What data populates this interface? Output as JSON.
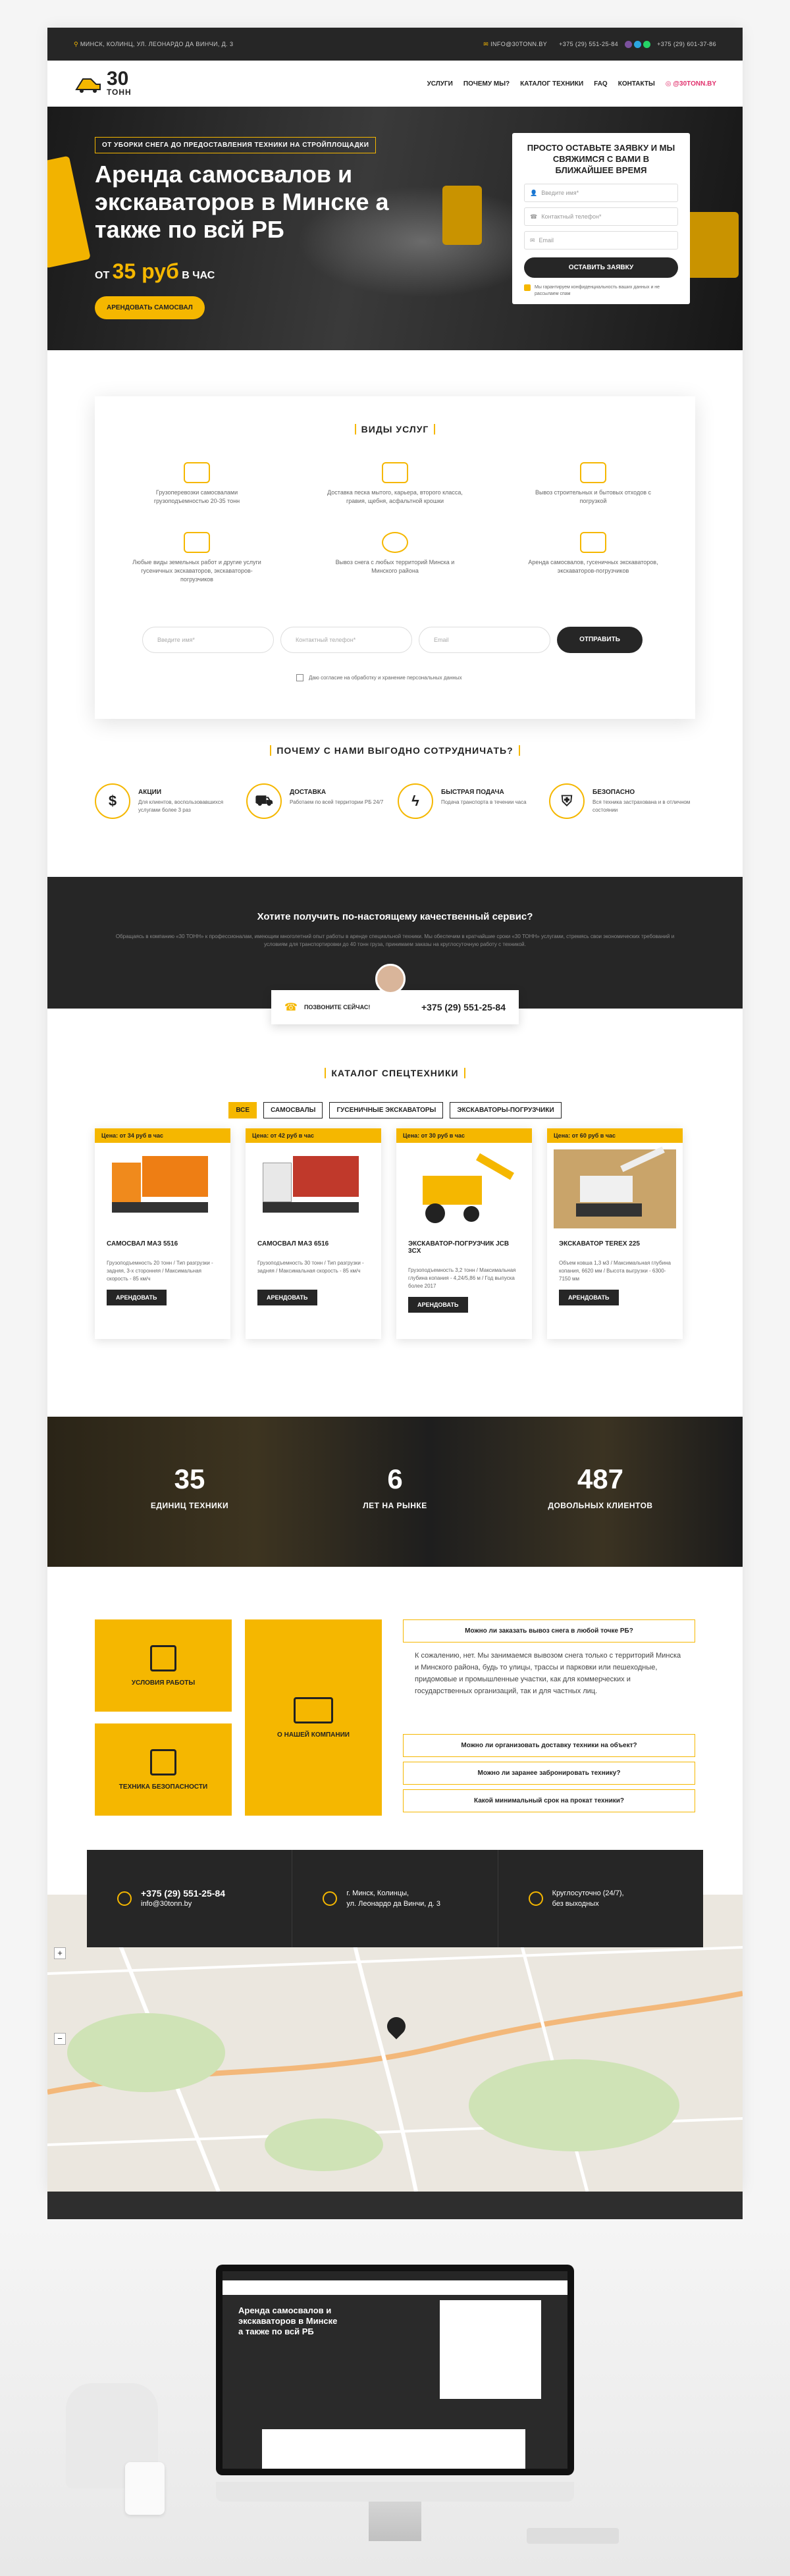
{
  "topbar": {
    "address": "МИНСК, КОЛИНЦ, УЛ. ЛЕОНАРДО ДА ВИНЧИ, Д. 3",
    "email": "INFO@30TONN.BY",
    "phone1": "+375 (29) 551-25-84",
    "phone2": "+375 (29) 601-37-86"
  },
  "logo": {
    "number": "30",
    "word": "ТОНН"
  },
  "menu": [
    "УСЛУГИ",
    "ПОЧЕМУ МЫ?",
    "КАТАЛОГ ТЕХНИКИ",
    "FAQ",
    "КОНТАКТЫ"
  ],
  "instagram": "@30TONN.BY",
  "hero": {
    "tag": "ОТ УБОРКИ СНЕГА ДО ПРЕДОСТАВЛЕНИЯ ТЕХНИКИ НА СТРОЙПЛОЩАДКИ",
    "title": "Аренда самосвалов и экскаваторов в Минске а также по всй РБ",
    "price_from": "ОТ",
    "price_value": "35 руб",
    "price_unit": "В ЧАС",
    "button": "АРЕНДОВАТЬ САМОСВАЛ"
  },
  "form": {
    "heading": "ПРОСТО ОСТАВЬТЕ ЗАЯВКУ И МЫ СВЯЖИМСЯ С ВАМИ В БЛИЖАЙШЕЕ ВРЕМЯ",
    "name": "Введите имя*",
    "phone": "Контактный телефон*",
    "email": "Email",
    "button": "ОСТАВИТЬ ЗАЯВКУ",
    "consent": "Мы гарантируем конфиденциальность ваших данных и не рассылаем спам"
  },
  "services": {
    "title": "ВИДЫ УСЛУГ",
    "items": [
      "Грузоперевозки самосвалами грузоподъемностью 20-35 тонн",
      "Доставка песка мытого, карьера, второго класса, гравия, щебня, асфальтной крошки",
      "Вывоз строительных и бытовых отходов с погрузкой",
      "Любые виды земельных работ и другие услуги гусеничных экскаваторов, экскаваторов-погрузчиков",
      "Вывоз снега с любых территорий Минска и Минского района",
      "Аренда самосвалов, гусеничных экскаваторов, экскаваторов-погрузчиков"
    ],
    "name_ph": "Введите имя*",
    "phone_ph": "Контактный телефон*",
    "email_ph": "Email",
    "send": "ОТПРАВИТЬ",
    "agree": "Даю согласие на обработку и хранение персональных данных"
  },
  "why": {
    "title": "ПОЧЕМУ С НАМИ ВЫГОДНО СОТРУДНИЧАТЬ?",
    "items": [
      {
        "icon": "$",
        "t": "АКЦИИ",
        "d": "Для клиентов, воспользовавшихся услугами более 3 раз"
      },
      {
        "icon": "truck",
        "t": "ДОСТАВКА",
        "d": "Работаем по всей территории РБ 24/7"
      },
      {
        "icon": "bolt",
        "t": "БЫСТРАЯ ПОДАЧА",
        "d": "Подача транспорта в течении часа"
      },
      {
        "icon": "shield",
        "t": "БЕЗОПАСНО",
        "d": "Вся техника застрахована и в отличном состоянии"
      }
    ]
  },
  "quality": {
    "title": "Хотите получить по-настоящему качественный сервис?",
    "text": "Обращаясь в компанию «30 ТОНН» к профессионалам, имеющим многолетний опыт работы в аренде специальной техники. Мы обеспечим в кратчайшие сроки «30 ТОНН» услугами, стремясь свои экономических требований и условиям для транспортировки до 40 тонн груза, принимаем заказы на круглосуточную работу с техникой.",
    "call": "ПОЗВОНИТЕ СЕЙЧАС!",
    "phone": "+375 (29) 551-25-84"
  },
  "catalog": {
    "title": "КАТАЛОГ СПЕЦТЕХНИКИ",
    "tabs": [
      "ВСЕ",
      "САМОСВАЛЫ",
      "ГУСЕНИЧНЫЕ ЭКСКАВАТОРЫ",
      "ЭКСКАВАТОРЫ-ПОГРУЗЧИКИ"
    ],
    "items": [
      {
        "price": "Цена: от 34 руб в час",
        "name": "САМОСВАЛ МАЗ 5516",
        "desc": "Грузоподъемность 20 тонн / Тип разгрузки - задняя, 3-х сторонняя / Максимальная скорость - 85 км/ч",
        "btn": "АРЕНДОВАТЬ"
      },
      {
        "price": "Цена: от 42 руб в час",
        "name": "САМОСВАЛ МАЗ 6516",
        "desc": "Грузоподъемность 30 тонн / Тип разгрузки - задняя / Максимальная скорость - 85 км/ч",
        "btn": "АРЕНДОВАТЬ"
      },
      {
        "price": "Цена: от 30 руб в час",
        "name": "ЭКСКАВАТОР-ПОГРУЗЧИК JCB 3CX",
        "desc": "Грузоподъемность 3,2 тонн / Максимальная глубина копания - 4,24/5,86 м / Год выпуска более 2017",
        "btn": "АРЕНДОВАТЬ"
      },
      {
        "price": "Цена: от 60 руб в час",
        "name": "ЭКСКАВАТОР TEREX 225",
        "desc": "Объем ковша 1,3 м3 / Максимальная глубина копания, 6620 мм / Высота выгрузки - 6300-7150 мм",
        "btn": "АРЕНДОВАТЬ"
      }
    ]
  },
  "stats": [
    {
      "n": "35",
      "l": "ЕДИНИЦ ТЕХНИКИ"
    },
    {
      "n": "6",
      "l": "ЛЕТ НА РЫНКЕ"
    },
    {
      "n": "487",
      "l": "ДОВОЛЬНЫХ КЛИЕНТОВ"
    }
  ],
  "tiles": [
    "УСЛОВИЯ РАБОТЫ",
    "ТЕХНИКА БЕЗОПАСНОСТИ",
    "О НАШЕЙ КОМПАНИИ"
  ],
  "faq": {
    "open_q": "Можно ли заказать вывоз снега в любой точке РБ?",
    "open_a": "К сожалению, нет. Мы занимаемся вывозом снега только с территорий Минска и Минского района, будь то улицы, трассы и парковки или пешеходные, придомовые и промышленные участки, как для коммерческих и государственных организаций, так и для частных лиц.",
    "questions": [
      "Можно ли организовать доставку техники на объект?",
      "Можно ли заранее забронировать технику?",
      "Какой минимальный срок на прокат техники?"
    ]
  },
  "contacts": {
    "phone": "+375 (29) 551-25-84",
    "email": "info@30tonn.by",
    "address1": "г. Минск, Колинцы,",
    "address2": "ул. Леонардо да Винчи, д. 3",
    "hours1": "Круглосуточно (24/7),",
    "hours2": "без выходных"
  },
  "colors": {
    "accent": "#f5b700",
    "dark": "#262626"
  }
}
